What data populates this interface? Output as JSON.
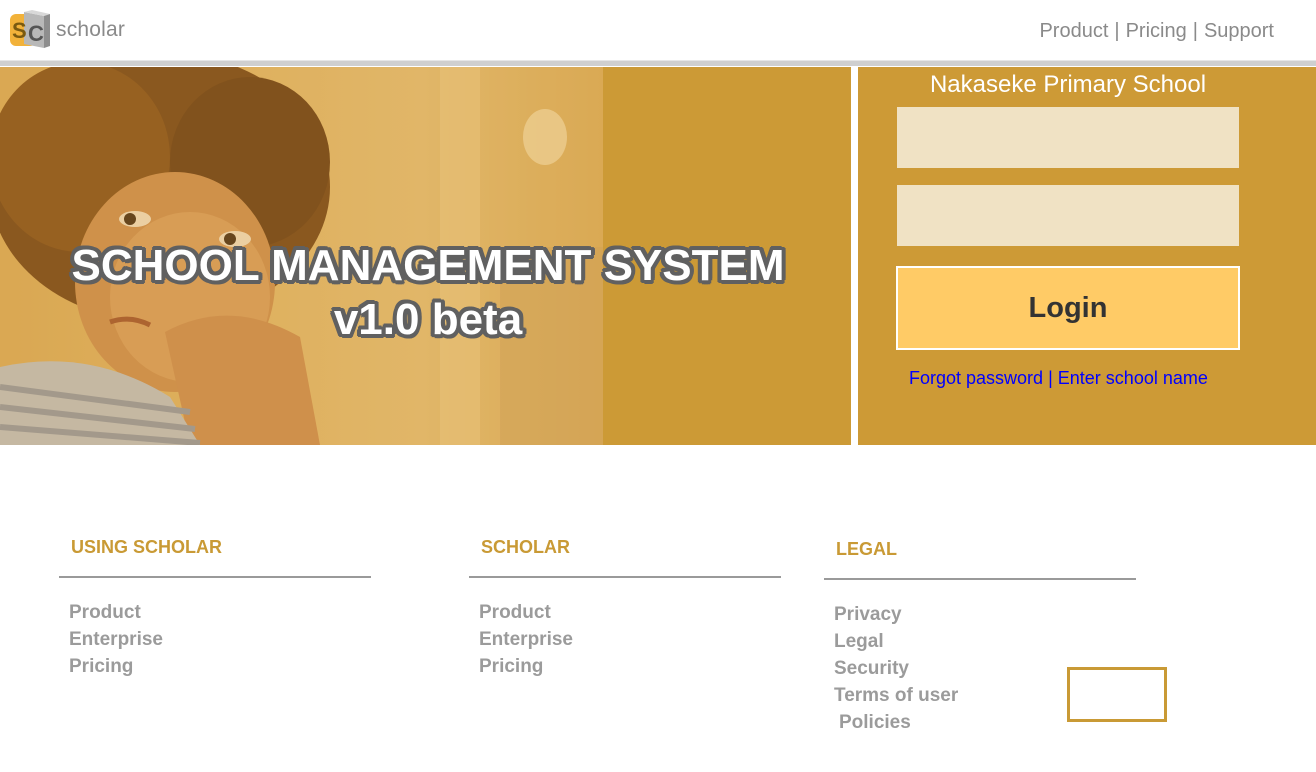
{
  "header": {
    "brand": "scholar",
    "logo_icon": "scholar-sc-logo",
    "nav": [
      "Product",
      "Pricing",
      "Support"
    ],
    "nav_separator": "|"
  },
  "hero": {
    "title_line1": "SCHOOL MANAGEMENT SYSTEM",
    "title_line2": "v1.0 beta",
    "image": "student-photo"
  },
  "login": {
    "school_name": "Nakaseke Primary School",
    "username_value": "",
    "password_value": "",
    "button_label": "Login",
    "forgot_link": "Forgot password",
    "link_separator": "|",
    "school_link": "Enter school name"
  },
  "footer": {
    "columns": [
      {
        "heading": "USING SCHOLAR",
        "links": [
          "Product",
          "Enterprise",
          "Pricing"
        ]
      },
      {
        "heading": "SCHOLAR",
        "links": [
          "Product",
          "Enterprise",
          "Pricing"
        ]
      },
      {
        "heading": "LEGAL",
        "links": [
          "Privacy",
          "Legal",
          "Security",
          "Terms of user",
          "Policies"
        ]
      }
    ]
  },
  "colors": {
    "accent": "#c99a35",
    "login_button": "#ffcb66",
    "input_bg": "#f0e2c4",
    "link": "#0000ff",
    "muted_text": "#8a8a8a"
  }
}
